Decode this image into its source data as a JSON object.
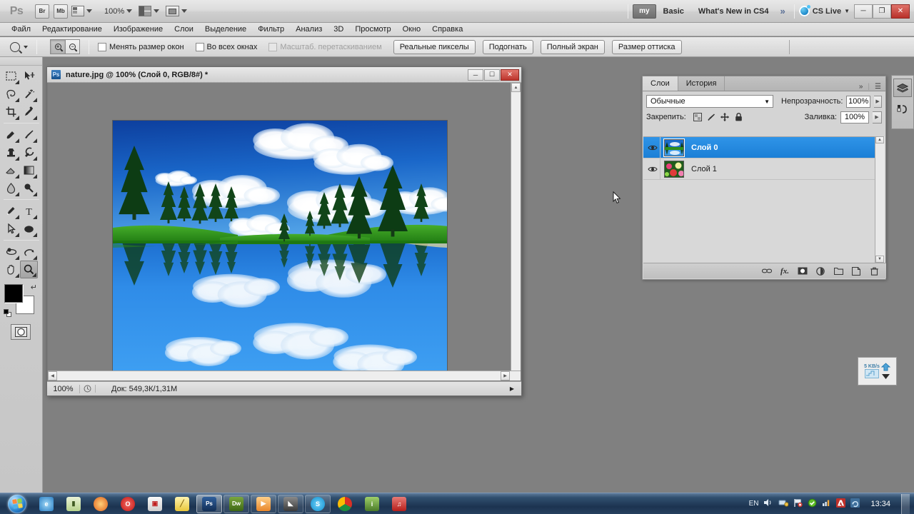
{
  "appbar": {
    "logo": "Ps",
    "buttons": [
      {
        "name": "bridge",
        "label": "Br"
      },
      {
        "name": "mini-bridge",
        "label": "Mb"
      }
    ],
    "view_extras_label": "",
    "zoom_level": "100%",
    "workspaces": [
      {
        "label": "my",
        "active": true
      },
      {
        "label": "Basic",
        "active": false
      },
      {
        "label": "What's New in CS4",
        "active": false
      }
    ],
    "more_workspaces": "»",
    "cs_live": "CS Live",
    "window_buttons": [
      "minimize",
      "restore",
      "close"
    ]
  },
  "menubar": {
    "items": [
      "Файл",
      "Редактирование",
      "Изображение",
      "Слои",
      "Выделение",
      "Фильтр",
      "Анализ",
      "3D",
      "Просмотр",
      "Окно",
      "Справка"
    ]
  },
  "options_bar": {
    "tool": "zoom-tool",
    "zoom_in_label": "+",
    "zoom_out_label": "−",
    "checkboxes": [
      {
        "label": "Менять размер окон",
        "checked": false,
        "disabled": false
      },
      {
        "label": "Во всех окнах",
        "checked": false,
        "disabled": false
      },
      {
        "label": "Масштаб. перетаскиванием",
        "checked": false,
        "disabled": true
      }
    ],
    "buttons": [
      "Реальные пикселы",
      "Подогнать",
      "Полный экран",
      "Размер оттиска"
    ]
  },
  "toolbar": {
    "tools": [
      {
        "name": "rectangular-marquee-tool",
        "glyph": "marquee"
      },
      {
        "name": "move-tool",
        "glyph": "move"
      },
      {
        "name": "lasso-tool",
        "glyph": "lasso"
      },
      {
        "name": "magic-wand-tool",
        "glyph": "wand"
      },
      {
        "name": "crop-tool",
        "glyph": "crop"
      },
      {
        "name": "eyedropper-tool",
        "glyph": "eyedropper"
      },
      {
        "name": "spot-healing-brush-tool",
        "glyph": "healing"
      },
      {
        "name": "brush-tool",
        "glyph": "brush"
      },
      {
        "name": "clone-stamp-tool",
        "glyph": "stamp"
      },
      {
        "name": "history-brush-tool",
        "glyph": "historybrush"
      },
      {
        "name": "eraser-tool",
        "glyph": "eraser"
      },
      {
        "name": "gradient-tool",
        "glyph": "gradient"
      },
      {
        "name": "blur-tool",
        "glyph": "blur"
      },
      {
        "name": "dodge-tool",
        "glyph": "dodge"
      },
      {
        "name": "pen-tool",
        "glyph": "pen"
      },
      {
        "name": "type-tool",
        "glyph": "T"
      },
      {
        "name": "path-selection-tool",
        "glyph": "arrow"
      },
      {
        "name": "ellipse-tool",
        "glyph": "ellipse"
      },
      {
        "name": "3d-rotate-tool",
        "glyph": "rotate3d"
      },
      {
        "name": "3d-orbit-tool",
        "glyph": "orbit3d"
      },
      {
        "name": "hand-tool",
        "glyph": "hand"
      },
      {
        "name": "zoom-tool",
        "glyph": "zoom",
        "selected": true
      }
    ],
    "foreground_color": "#000000",
    "background_color": "#ffffff",
    "quick_mask": "quick-mask-mode"
  },
  "document": {
    "title": "nature.jpg @ 100% (Слой 0, RGB/8#) *",
    "icon_label": "Ps",
    "status": {
      "zoom": "100%",
      "doc_info": "Док: 549,3К/1,31М"
    }
  },
  "layers_panel": {
    "tabs": [
      {
        "label": "Слои",
        "active": true
      },
      {
        "label": "История",
        "active": false
      }
    ],
    "blend_mode": "Обычные",
    "opacity_label": "Непрозрачность:",
    "opacity_value": "100%",
    "fill_label": "Заливка:",
    "fill_value": "100%",
    "lock_label": "Закрепить:",
    "lock_icons": [
      "lock-transparent-pixels-icon",
      "lock-image-pixels-icon",
      "lock-position-icon",
      "lock-all-icon"
    ],
    "layers": [
      {
        "name": "Слой 0",
        "selected": true,
        "visible": true,
        "thumb": "landscape"
      },
      {
        "name": "Слой 1",
        "selected": false,
        "visible": true,
        "thumb": "flowers"
      }
    ],
    "footer_icons": [
      "link-layers-icon",
      "layer-style-icon",
      "layer-mask-icon",
      "adjustment-layer-icon",
      "new-group-icon",
      "new-layer-icon",
      "delete-layer-icon"
    ],
    "selected_color": "#1b7fd6"
  },
  "right_dock": {
    "items": [
      {
        "name": "layers-dock-icon",
        "active": true
      },
      {
        "name": "channels-dock-icon",
        "active": false
      }
    ]
  },
  "floating_widget": {
    "label": "5 KB/s"
  },
  "taskbar": {
    "start_label": "start",
    "apps": [
      {
        "name": "internet-explorer",
        "color": "#3fa0e0",
        "glyph": "e"
      },
      {
        "name": "notepad-app",
        "color": "#cfe3b6",
        "glyph": ""
      },
      {
        "name": "firefox-browser",
        "color": "#e8761f",
        "glyph": ""
      },
      {
        "name": "opera-browser",
        "color": "#d5231f",
        "glyph": "O"
      },
      {
        "name": "save-utility",
        "color": "#e8e8e8",
        "glyph": ""
      },
      {
        "name": "editor-app",
        "color": "#f2d24a",
        "glyph": ""
      },
      {
        "name": "photoshop-app",
        "color": "#1c3f70",
        "glyph": "Ps",
        "active": true
      },
      {
        "name": "dreamweaver-app",
        "color": "#4e7a1e",
        "glyph": "Dw"
      },
      {
        "name": "media-player",
        "color": "#f2a23c",
        "glyph": ""
      },
      {
        "name": "utility-app",
        "color": "#3c3c3c",
        "glyph": ""
      },
      {
        "name": "skype-app",
        "color": "#1aa3e0",
        "glyph": "S"
      },
      {
        "name": "chrome-browser",
        "color": "#d93025",
        "glyph": ""
      },
      {
        "name": "info-app",
        "color": "#5a8c3a",
        "glyph": "i"
      },
      {
        "name": "media-app",
        "color": "#c7312c",
        "glyph": ""
      }
    ],
    "tray": {
      "language": "EN",
      "icons": [
        "volume-icon",
        "network-icon",
        "flag-warning-icon",
        "antivirus-icon",
        "stats-icon",
        "adobe-updater-icon",
        "sync-icon"
      ],
      "clock": "13:34"
    }
  },
  "canvas_image": {
    "description": "Mirrored lake landscape with conifer trees, green banks, blue sky and white clouds",
    "sky_color": "#1c63c4",
    "water_color": "#2a86e8",
    "grass_color": "#2f8f1e",
    "tree_color": "#0d3d12"
  }
}
